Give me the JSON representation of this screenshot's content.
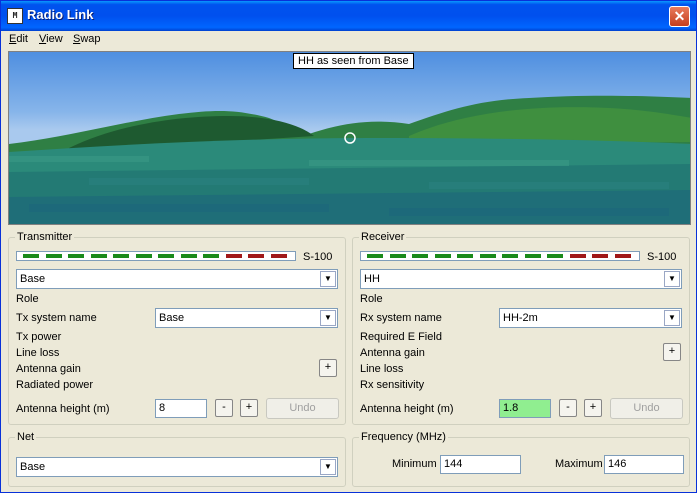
{
  "window": {
    "title": "Radio Link",
    "icon": "app-icon",
    "close": "✕"
  },
  "menu": [
    {
      "u": "E",
      "rest": "dit"
    },
    {
      "u": "V",
      "rest": "iew"
    },
    {
      "u": "S",
      "rest": "wap"
    }
  ],
  "view3d": {
    "caption": "HH as seen from Base"
  },
  "transmitter": {
    "title": "Transmitter",
    "meter_label": "S-100",
    "meter_level": 0.75,
    "station": "Base",
    "role": "Role",
    "system_label": "Tx system name",
    "system_value": "Base",
    "power": "Tx power",
    "loss": "Line loss",
    "gain": "Antenna gain",
    "gain_btn": "+",
    "radiated": "Radiated power",
    "height_label": "Antenna height (m)",
    "height_value": "8",
    "minus": "-",
    "plus": "+",
    "undo": "Undo"
  },
  "receiver": {
    "title": "Receiver",
    "meter_label": "S-100",
    "meter_level": 0.75,
    "station": "HH",
    "role": "Role",
    "system_label": "Rx system name",
    "system_value": "HH-2m",
    "efield": "Required E Field",
    "gain": "Antenna gain",
    "gain_btn": "+",
    "loss": "Line loss",
    "sensitivity": "Rx sensitivity",
    "height_label": "Antenna height (m)",
    "height_value": "1.8",
    "minus": "-",
    "plus": "+",
    "undo": "Undo"
  },
  "net": {
    "title": "Net",
    "value": "Base"
  },
  "frequency": {
    "title": "Frequency (MHz)",
    "min_label": "Minimum",
    "min_value": "144",
    "max_label": "Maximum",
    "max_value": "146"
  },
  "colors": {
    "meter_green": "#1a8a1a",
    "meter_red": "#a01818",
    "field_green": "#90ee90"
  }
}
